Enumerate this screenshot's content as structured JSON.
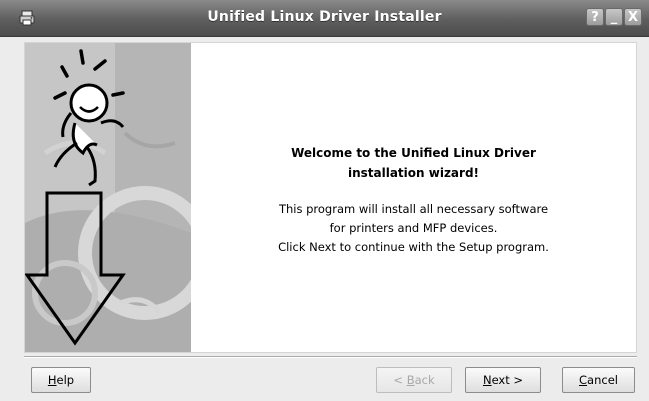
{
  "window": {
    "title": "Unified Linux Driver Installer",
    "controls": {
      "help": "?",
      "minimize": "_",
      "close": "X"
    }
  },
  "welcome": {
    "title_line1": "Welcome to the Unified Linux Driver",
    "title_line2": "installation wizard!",
    "body_line1": "This program will install all necessary software",
    "body_line2": "for printers and MFP devices.",
    "body_line3": "Click Next to continue with the Setup program."
  },
  "buttons": {
    "help": {
      "mnemonic": "H",
      "rest": "elp",
      "enabled": true
    },
    "back": {
      "prefix": "< ",
      "mnemonic": "B",
      "rest": "ack",
      "enabled": false
    },
    "next": {
      "mnemonic": "N",
      "rest": "ext >",
      "enabled": true
    },
    "cancel": {
      "mnemonic": "C",
      "rest": "ancel",
      "enabled": true
    }
  },
  "icons": {
    "app": "printer-icon",
    "banner": "dancing-figure-illustration",
    "arrow": "down-arrow-icon"
  },
  "colors": {
    "titlebar": "#5e5e5e",
    "title_text": "#ffffff",
    "banner_bg": "#b9b9b9",
    "disabled_text": "#a8a8a8"
  }
}
